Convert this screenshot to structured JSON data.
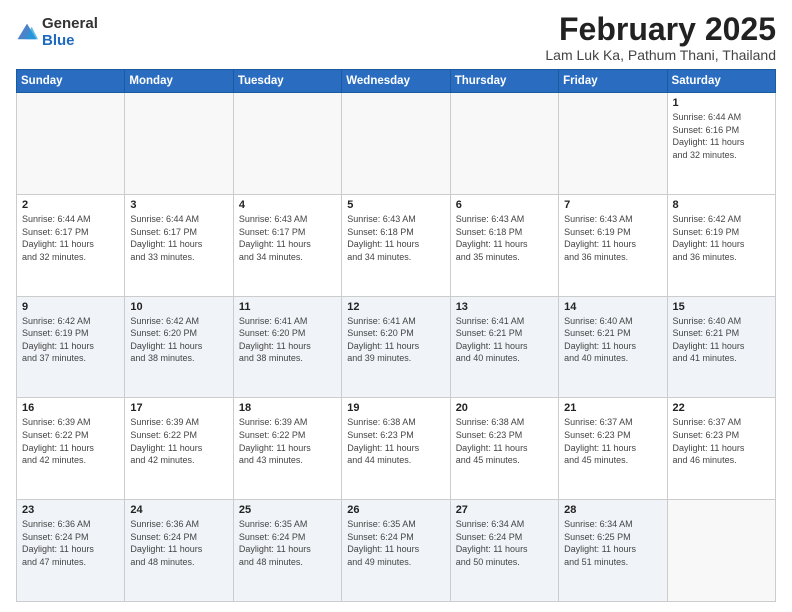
{
  "logo": {
    "general": "General",
    "blue": "Blue"
  },
  "title": "February 2025",
  "subtitle": "Lam Luk Ka, Pathum Thani, Thailand",
  "weekdays": [
    "Sunday",
    "Monday",
    "Tuesday",
    "Wednesday",
    "Thursday",
    "Friday",
    "Saturday"
  ],
  "weeks": [
    [
      {
        "day": "",
        "info": ""
      },
      {
        "day": "",
        "info": ""
      },
      {
        "day": "",
        "info": ""
      },
      {
        "day": "",
        "info": ""
      },
      {
        "day": "",
        "info": ""
      },
      {
        "day": "",
        "info": ""
      },
      {
        "day": "1",
        "info": "Sunrise: 6:44 AM\nSunset: 6:16 PM\nDaylight: 11 hours\nand 32 minutes."
      }
    ],
    [
      {
        "day": "2",
        "info": "Sunrise: 6:44 AM\nSunset: 6:17 PM\nDaylight: 11 hours\nand 32 minutes."
      },
      {
        "day": "3",
        "info": "Sunrise: 6:44 AM\nSunset: 6:17 PM\nDaylight: 11 hours\nand 33 minutes."
      },
      {
        "day": "4",
        "info": "Sunrise: 6:43 AM\nSunset: 6:17 PM\nDaylight: 11 hours\nand 34 minutes."
      },
      {
        "day": "5",
        "info": "Sunrise: 6:43 AM\nSunset: 6:18 PM\nDaylight: 11 hours\nand 34 minutes."
      },
      {
        "day": "6",
        "info": "Sunrise: 6:43 AM\nSunset: 6:18 PM\nDaylight: 11 hours\nand 35 minutes."
      },
      {
        "day": "7",
        "info": "Sunrise: 6:43 AM\nSunset: 6:19 PM\nDaylight: 11 hours\nand 36 minutes."
      },
      {
        "day": "8",
        "info": "Sunrise: 6:42 AM\nSunset: 6:19 PM\nDaylight: 11 hours\nand 36 minutes."
      }
    ],
    [
      {
        "day": "9",
        "info": "Sunrise: 6:42 AM\nSunset: 6:19 PM\nDaylight: 11 hours\nand 37 minutes."
      },
      {
        "day": "10",
        "info": "Sunrise: 6:42 AM\nSunset: 6:20 PM\nDaylight: 11 hours\nand 38 minutes."
      },
      {
        "day": "11",
        "info": "Sunrise: 6:41 AM\nSunset: 6:20 PM\nDaylight: 11 hours\nand 38 minutes."
      },
      {
        "day": "12",
        "info": "Sunrise: 6:41 AM\nSunset: 6:20 PM\nDaylight: 11 hours\nand 39 minutes."
      },
      {
        "day": "13",
        "info": "Sunrise: 6:41 AM\nSunset: 6:21 PM\nDaylight: 11 hours\nand 40 minutes."
      },
      {
        "day": "14",
        "info": "Sunrise: 6:40 AM\nSunset: 6:21 PM\nDaylight: 11 hours\nand 40 minutes."
      },
      {
        "day": "15",
        "info": "Sunrise: 6:40 AM\nSunset: 6:21 PM\nDaylight: 11 hours\nand 41 minutes."
      }
    ],
    [
      {
        "day": "16",
        "info": "Sunrise: 6:39 AM\nSunset: 6:22 PM\nDaylight: 11 hours\nand 42 minutes."
      },
      {
        "day": "17",
        "info": "Sunrise: 6:39 AM\nSunset: 6:22 PM\nDaylight: 11 hours\nand 42 minutes."
      },
      {
        "day": "18",
        "info": "Sunrise: 6:39 AM\nSunset: 6:22 PM\nDaylight: 11 hours\nand 43 minutes."
      },
      {
        "day": "19",
        "info": "Sunrise: 6:38 AM\nSunset: 6:23 PM\nDaylight: 11 hours\nand 44 minutes."
      },
      {
        "day": "20",
        "info": "Sunrise: 6:38 AM\nSunset: 6:23 PM\nDaylight: 11 hours\nand 45 minutes."
      },
      {
        "day": "21",
        "info": "Sunrise: 6:37 AM\nSunset: 6:23 PM\nDaylight: 11 hours\nand 45 minutes."
      },
      {
        "day": "22",
        "info": "Sunrise: 6:37 AM\nSunset: 6:23 PM\nDaylight: 11 hours\nand 46 minutes."
      }
    ],
    [
      {
        "day": "23",
        "info": "Sunrise: 6:36 AM\nSunset: 6:24 PM\nDaylight: 11 hours\nand 47 minutes."
      },
      {
        "day": "24",
        "info": "Sunrise: 6:36 AM\nSunset: 6:24 PM\nDaylight: 11 hours\nand 48 minutes."
      },
      {
        "day": "25",
        "info": "Sunrise: 6:35 AM\nSunset: 6:24 PM\nDaylight: 11 hours\nand 48 minutes."
      },
      {
        "day": "26",
        "info": "Sunrise: 6:35 AM\nSunset: 6:24 PM\nDaylight: 11 hours\nand 49 minutes."
      },
      {
        "day": "27",
        "info": "Sunrise: 6:34 AM\nSunset: 6:24 PM\nDaylight: 11 hours\nand 50 minutes."
      },
      {
        "day": "28",
        "info": "Sunrise: 6:34 AM\nSunset: 6:25 PM\nDaylight: 11 hours\nand 51 minutes."
      },
      {
        "day": "",
        "info": ""
      }
    ]
  ]
}
